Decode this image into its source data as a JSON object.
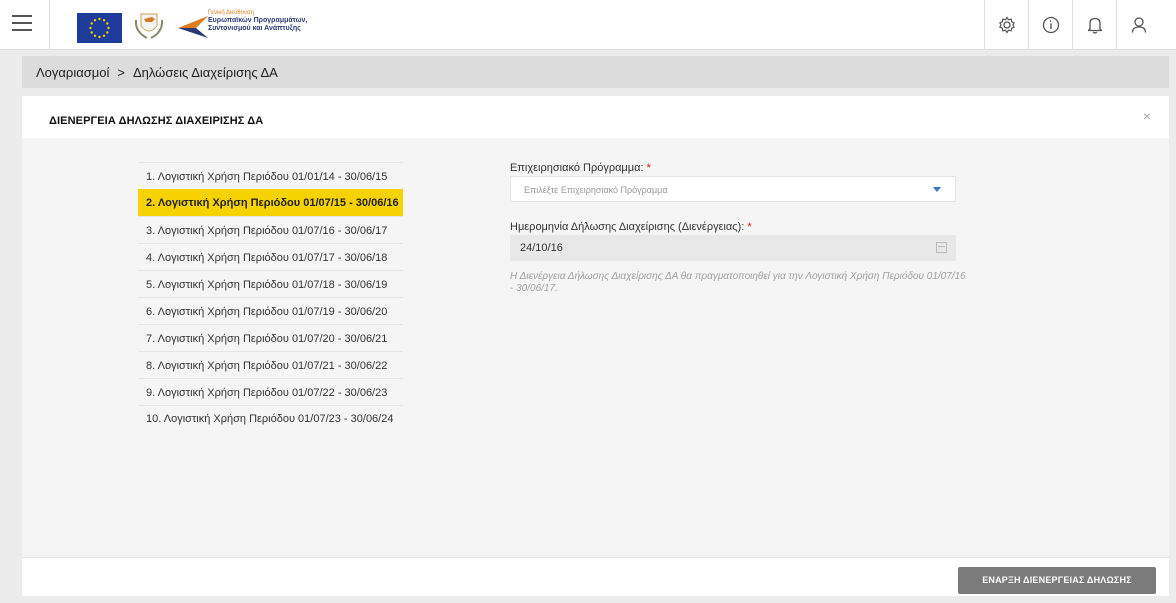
{
  "header": {
    "agency_lines": [
      "Γενική Διεύθυνση",
      "Ευρωπαϊκών Προγραμμάτων,",
      "Συντονισμού και Ανάπτυξης"
    ],
    "icons": [
      "menu-icon",
      "gear-icon",
      "info-icon",
      "bell-icon",
      "user-icon"
    ]
  },
  "breadcrumb": {
    "items": [
      "Λογαριασμοί",
      "Δηλώσεις Διαχείρισης ΔΑ"
    ],
    "separator": ">"
  },
  "card": {
    "title": "ΔΙΕΝΕΡΓΕΙΑ ΔΗΛΩΣΗΣ ΔΙΑΧΕΙΡΙΣΗΣ ΔΑ",
    "close": "×",
    "periods": [
      "1. Λογιστική Χρήση Περιόδου 01/01/14 - 30/06/15",
      "2. Λογιστική Χρήση Περιόδου 01/07/15 - 30/06/16",
      "3. Λογιστική Χρήση Περιόδου 01/07/16 - 30/06/17",
      "4. Λογιστική Χρήση Περιόδου 01/07/17 - 30/06/18",
      "5. Λογιστική Χρήση Περιόδου 01/07/18 - 30/06/19",
      "6. Λογιστική Χρήση Περιόδου 01/07/19 - 30/06/20",
      "7. Λογιστική Χρήση Περιόδου 01/07/20 - 30/06/21",
      "8. Λογιστική Χρήση Περιόδου 01/07/21 - 30/06/22",
      "9. Λογιστική Χρήση Περιόδου 01/07/22 - 30/06/23",
      "10. Λογιστική Χρήση Περιόδου 01/07/23 - 30/06/24"
    ],
    "active_period_index": 1,
    "form": {
      "program_label": "Επιχειρησιακό Πρόγραμμα:",
      "program_placeholder": "Επιλέξτε Επιχειρησιακό Πρόγραμμα",
      "date_label": "Ημερομηνία Δήλωσης Διαχείρισης (Διενέργειας):",
      "date_value": "24/10/16",
      "required_mark": "*",
      "hint": "Η Διενέργεια Δήλωσης Διαχείρισης ΔΑ θα πραγματοποιηθεί για την Λογιστική Χρήση Περιόδου 01/07/16 - 30/06/17."
    },
    "start_button": "ΕΝΑΡΞΗ ΔΙΕΝΕΡΓΕΙΑΣ ΔΗΛΩΣΗΣ"
  },
  "colors": {
    "active_period": "#f6d200",
    "button": "#7b7b7b",
    "required": "#dd1111",
    "caret": "#3a73c9"
  }
}
